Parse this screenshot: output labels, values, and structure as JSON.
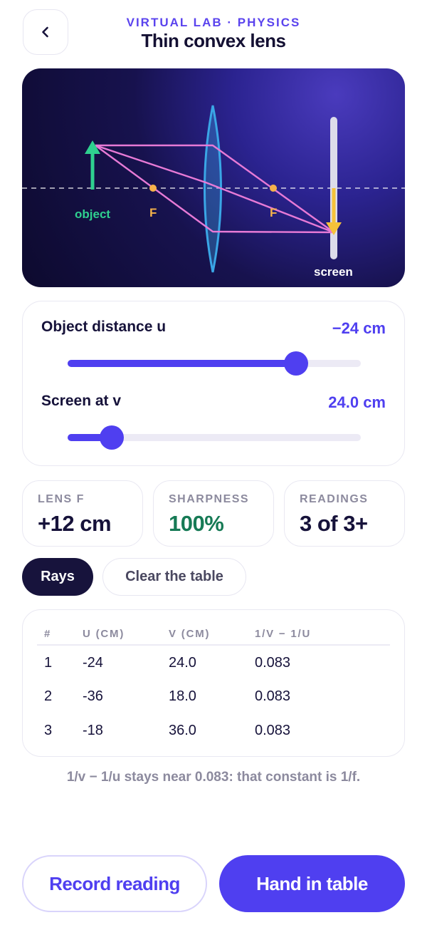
{
  "header": {
    "kicker": "VIRTUAL LAB · PHYSICS",
    "title": "Thin convex lens",
    "back_icon": "chevron-left-icon"
  },
  "scene": {
    "object_label": "object",
    "focus_label_left": "F",
    "focus_label_right": "F",
    "screen_label": "screen",
    "colors": {
      "object": "#2fd08f",
      "image": "#f5c23a",
      "rays": "#e77ad6",
      "lens": "#3aa6e6",
      "focus": "#f5b24a"
    }
  },
  "controls": {
    "object_distance": {
      "label": "Object distance u",
      "value": "−24 cm",
      "level": 0.78
    },
    "screen_position": {
      "label": "Screen at v",
      "value": "24.0 cm",
      "level": 0.15
    }
  },
  "stats": [
    {
      "label": "LENS F",
      "value": "+12 cm",
      "color": "#16123a"
    },
    {
      "label": "SHARPNESS",
      "value": "100%",
      "color": "#167a55"
    },
    {
      "label": "READINGS",
      "value": "3 of 3+",
      "color": "#16123a"
    }
  ],
  "toggles": {
    "rays_label": "Rays",
    "clear_label": "Clear the table"
  },
  "table": {
    "headers": [
      "#",
      "U (CM)",
      "V (CM)",
      "1/V − 1/U"
    ],
    "rows": [
      [
        "1",
        "-24",
        "24.0",
        "0.083"
      ],
      [
        "2",
        "-36",
        "18.0",
        "0.083"
      ],
      [
        "3",
        "-18",
        "36.0",
        "0.083"
      ]
    ]
  },
  "note": "1/v − 1/u stays near 0.083: that constant is 1/f.",
  "actions": {
    "record_label": "Record reading",
    "hand_in_label": "Hand in table"
  }
}
